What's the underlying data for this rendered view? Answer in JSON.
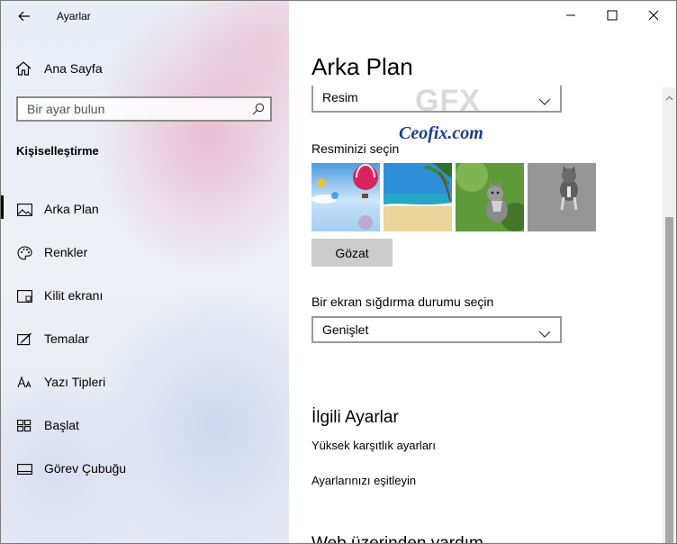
{
  "window": {
    "app_title": "Ayarlar"
  },
  "sidebar": {
    "home_label": "Ana Sayfa",
    "search_placeholder": "Bir ayar bulun",
    "section_title": "Kişiselleştirme",
    "items": [
      {
        "label": "Arka Plan",
        "icon": "image-icon",
        "active": true
      },
      {
        "label": "Renkler",
        "icon": "palette-icon",
        "active": false
      },
      {
        "label": "Kilit ekranı",
        "icon": "lock-screen-icon",
        "active": false
      },
      {
        "label": "Temalar",
        "icon": "themes-icon",
        "active": false
      },
      {
        "label": "Yazı Tipleri",
        "icon": "fonts-icon",
        "active": false
      },
      {
        "label": "Başlat",
        "icon": "start-icon",
        "active": false
      },
      {
        "label": "Görev Çubuğu",
        "icon": "taskbar-icon",
        "active": false
      }
    ]
  },
  "main": {
    "page_title": "Arka Plan",
    "background_dropdown_value": "Resim",
    "choose_picture_label": "Resminizi seçin",
    "browse_label": "Gözat",
    "fit_label": "Bir ekran sığdırma durumu seçin",
    "fit_dropdown_value": "Genişlet",
    "related_title": "İlgili Ayarlar",
    "links": [
      "Yüksek karşıtlık ayarları",
      "Ayarlarınızı eşitleyin"
    ],
    "cutoff_heading": "Web üzerinden yardım"
  },
  "watermark": {
    "logo_text": "GFX",
    "brand_text": "Ceofix.com"
  },
  "colors": {
    "accent": "#000000",
    "button_bg": "#cccccc",
    "brand_blue": "#1a3f8a"
  }
}
